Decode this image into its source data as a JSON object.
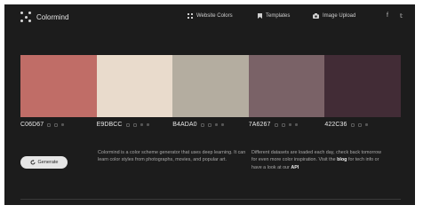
{
  "nav": {
    "brand": "Colormind",
    "links": [
      {
        "label": "Website Colors",
        "icon": "grid-icon"
      },
      {
        "label": "Templates",
        "icon": "bookmark-icon"
      },
      {
        "label": "Image Upload",
        "icon": "camera-icon"
      }
    ],
    "social": [
      {
        "label": "f",
        "icon": "facebook-icon"
      },
      {
        "label": "𝕥",
        "icon": "twitter-icon"
      }
    ]
  },
  "palette": {
    "swatches": [
      {
        "hex": "C06D67",
        "color": "#C06D67"
      },
      {
        "hex": "E9DBCC",
        "color": "#E9DBCC"
      },
      {
        "hex": "B4ADA0",
        "color": "#B4ADA0"
      },
      {
        "hex": "7A6267",
        "color": "#7A6267"
      },
      {
        "hex": "422C36",
        "color": "#422C36"
      }
    ]
  },
  "generate_button": {
    "label": "Generate",
    "icon": "refresh-icon"
  },
  "description": {
    "left": "Colormind is a color scheme generator that uses deep learning. It can learn color styles from photographs, movies, and popular art.",
    "right_part1": "Different datasets are loaded each day, check back tomorrow for even more color inspiration. Visit the ",
    "right_link1": "blog",
    "right_part2": " for tech info or have a look at our ",
    "right_link2": "API"
  }
}
